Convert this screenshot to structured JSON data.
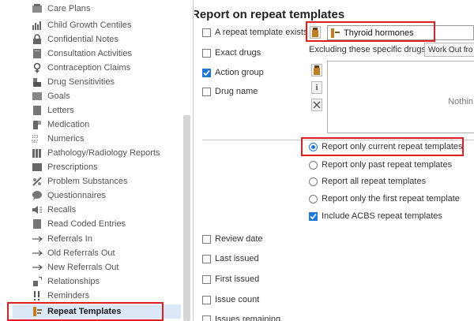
{
  "sidebar": {
    "items": [
      {
        "label": "Care Plans",
        "icon": "care-plans-icon"
      },
      {
        "label": "Child Growth Centiles",
        "icon": "chart-icon"
      },
      {
        "label": "Confidential Notes",
        "icon": "lock-icon"
      },
      {
        "label": "Consultation Activities",
        "icon": "folder-icon"
      },
      {
        "label": "Contraception Claims",
        "icon": "female-symbol-icon"
      },
      {
        "label": "Drug Sensitivities",
        "icon": "drug-sensitivity-icon"
      },
      {
        "label": "Goals",
        "icon": "goals-icon"
      },
      {
        "label": "Letters",
        "icon": "letter-icon"
      },
      {
        "label": "Medication",
        "icon": "medication-icon"
      },
      {
        "label": "Numerics",
        "icon": "numerics-icon"
      },
      {
        "label": "Pathology/Radiology Reports",
        "icon": "lab-report-icon"
      },
      {
        "label": "Prescriptions",
        "icon": "prescription-icon"
      },
      {
        "label": "Problem Substances",
        "icon": "problem-substance-icon"
      },
      {
        "label": "Questionnaires",
        "icon": "speech-bubble-icon"
      },
      {
        "label": "Recalls",
        "icon": "recall-icon"
      },
      {
        "label": "Read Coded Entries",
        "icon": "coded-entry-icon"
      },
      {
        "label": "Referrals In",
        "icon": "arrow-right-icon"
      },
      {
        "label": "Old Referrals Out",
        "icon": "arrow-right-icon"
      },
      {
        "label": "New Referrals Out",
        "icon": "arrow-right-icon"
      },
      {
        "label": "Relationships",
        "icon": "relationships-icon"
      },
      {
        "label": "Reminders",
        "icon": "exclamation-icon"
      },
      {
        "label": "Repeat Templates",
        "icon": "repeat-template-icon"
      }
    ],
    "selected": "Repeat Templates"
  },
  "report": {
    "title": "Report on repeat templates",
    "template_exists_label": "A repeat template exists",
    "template_exists_checked": false,
    "template_value": "Thyroid hormones",
    "exact_drugs_label": "Exact drugs",
    "exact_drugs_checked": false,
    "excluding_label": "Excluding these specific drugs",
    "work_out_button": "Work Out fro",
    "action_group_label": "Action group",
    "action_group_checked": true,
    "drug_name_label": "Drug name",
    "drug_name_checked": false,
    "nothing_text": "Nothin",
    "radio_options": [
      {
        "label": "Report only current repeat templates",
        "selected": true
      },
      {
        "label": "Report only past repeat templates",
        "selected": false
      },
      {
        "label": "Report all repeat templates",
        "selected": false
      },
      {
        "label": "Report only the first repeat template",
        "selected": false
      }
    ],
    "include_acbs_label": "Include ACBS repeat templates",
    "include_acbs_checked": true,
    "review_date_label": "Review date",
    "last_issued_label": "Last issued",
    "first_issued_label": "First issued",
    "issue_count_label": "Issue count",
    "issues_remaining_label": "Issues remaining"
  },
  "colors": {
    "highlight": "#e02020",
    "accent": "#1f78d1",
    "selected_row": "#dbe8f8"
  }
}
